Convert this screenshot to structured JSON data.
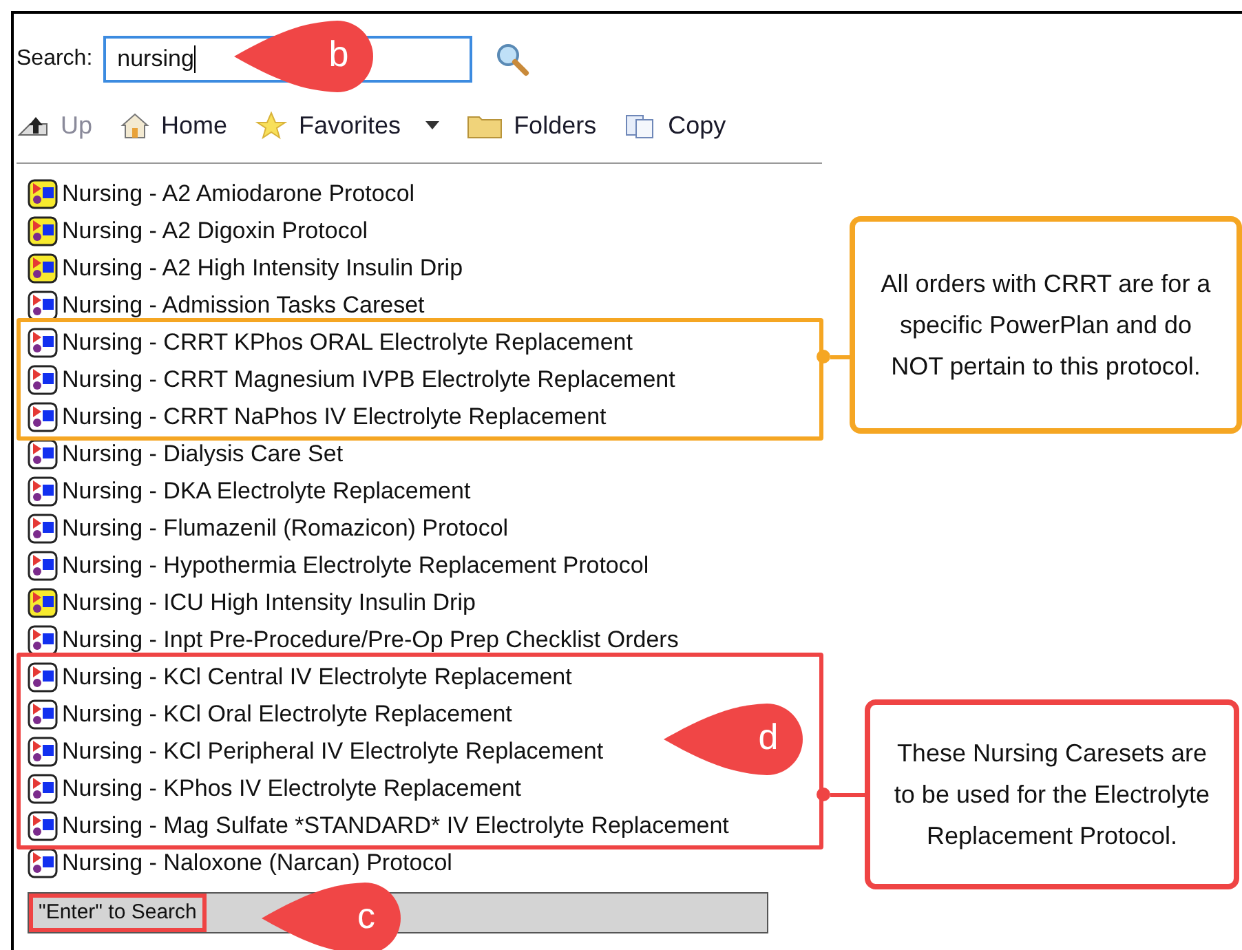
{
  "search": {
    "label": "Search:",
    "value": "nursing"
  },
  "toolbar": [
    {
      "label": "Up",
      "kind": "up",
      "disabled": true
    },
    {
      "label": "Home",
      "kind": "home",
      "disabled": false
    },
    {
      "label": "Favorites",
      "kind": "favorites",
      "disabled": false
    },
    {
      "label": "Folders",
      "kind": "folders",
      "disabled": false
    },
    {
      "label": "Copy",
      "kind": "copy",
      "disabled": false
    }
  ],
  "list": [
    {
      "label": "Nursing - A2 Amiodarone Protocol",
      "kind": "yellow"
    },
    {
      "label": "Nursing - A2 Digoxin Protocol",
      "kind": "yellow"
    },
    {
      "label": "Nursing - A2 High Intensity Insulin Drip",
      "kind": "yellow"
    },
    {
      "label": "Nursing - Admission Tasks Careset",
      "kind": "plain"
    },
    {
      "label": "Nursing - CRRT KPhos ORAL Electrolyte Replacement",
      "kind": "plain"
    },
    {
      "label": "Nursing - CRRT Magnesium IVPB Electrolyte Replacement",
      "kind": "plain"
    },
    {
      "label": "Nursing - CRRT NaPhos IV Electrolyte Replacement",
      "kind": "plain"
    },
    {
      "label": "Nursing - Dialysis Care Set",
      "kind": "plain"
    },
    {
      "label": "Nursing - DKA Electrolyte Replacement",
      "kind": "plain"
    },
    {
      "label": "Nursing - Flumazenil (Romazicon) Protocol",
      "kind": "plain"
    },
    {
      "label": "Nursing - Hypothermia Electrolyte Replacement Protocol",
      "kind": "plain"
    },
    {
      "label": "Nursing - ICU High Intensity Insulin Drip",
      "kind": "yellow"
    },
    {
      "label": "Nursing - Inpt Pre-Procedure/Pre-Op Prep Checklist Orders",
      "kind": "plain"
    },
    {
      "label": "Nursing - KCl Central IV Electrolyte Replacement",
      "kind": "plain"
    },
    {
      "label": "Nursing - KCl Oral Electrolyte Replacement",
      "kind": "plain"
    },
    {
      "label": "Nursing - KCl Peripheral IV Electrolyte Replacement",
      "kind": "plain"
    },
    {
      "label": "Nursing - KPhos IV Electrolyte Replacement",
      "kind": "plain"
    },
    {
      "label": "Nursing - Mag Sulfate *STANDARD* IV Electrolyte Replacement",
      "kind": "plain"
    },
    {
      "label": "Nursing - Naloxone (Narcan) Protocol",
      "kind": "plain"
    }
  ],
  "status_bar": {
    "text": "\"Enter\" to Search"
  },
  "callouts": [
    {
      "text": "All orders with CRRT are for a specific PowerPlan and do NOT pertain to this protocol.",
      "color": "#f5a623"
    },
    {
      "text": "These Nursing Caresets are to be used for the Electrolyte Replacement Protocol.",
      "color": "#ef4444"
    }
  ],
  "markers": [
    {
      "letter": "b"
    },
    {
      "letter": "c"
    },
    {
      "letter": "d"
    }
  ]
}
